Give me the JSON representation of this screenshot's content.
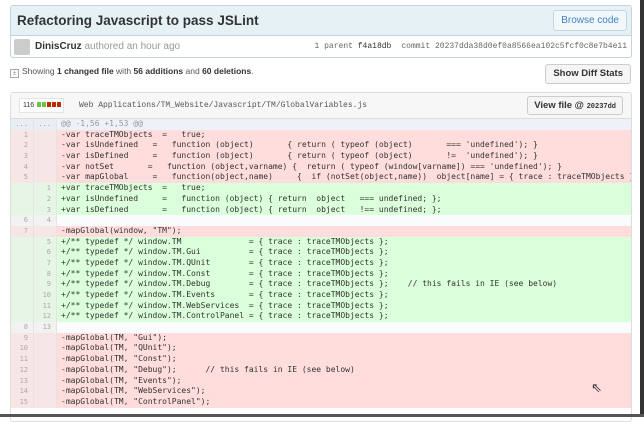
{
  "commit": {
    "title": "Refactoring Javascript to pass JSLint",
    "browse_label": "Browse code",
    "author": "DinisCruz",
    "authored": "authored an hour ago",
    "parent_label": "1 parent",
    "parent_sha": "f4a18db",
    "commit_label": "commit",
    "commit_sha": "20237dda38d0ef0a8566ea102c5fcf0c8e7b4e11"
  },
  "summary": {
    "prefix": "Showing",
    "files": "1 changed file",
    "with": "with",
    "additions": "56 additions",
    "and": "and",
    "deletions": "60 deletions",
    "suffix": ".",
    "stats_button": "Show Diff Stats"
  },
  "file": {
    "changes": "116",
    "path": "Web Applications/TM_Website/Javascript/TM/GlobalVariables.js",
    "view_label": "View file @",
    "view_sha": "20237dd",
    "bar_colors": [
      "#6cc644",
      "#6cc644",
      "#bd2c00",
      "#bd2c00",
      "#bd2c00"
    ]
  },
  "diff": [
    {
      "t": "hunk",
      "o": "...",
      "n": "...",
      "c": "@@ -1,56 +1,53 @@"
    },
    {
      "t": "del",
      "o": "1",
      "n": "",
      "c": "-var traceTMObjects  =   true;"
    },
    {
      "t": "del",
      "o": "2",
      "n": "",
      "c": "-var isUndefined   =   function (object)       { return ( typeof (object)       === 'undefined'); }"
    },
    {
      "t": "del",
      "o": "3",
      "n": "",
      "c": "-var isDefined     =   function (object)       { return ( typeof (object)       !=  'undefined'); }"
    },
    {
      "t": "del",
      "o": "4",
      "n": "",
      "c": "-var notSet       =   function (object,varname) {  return ( typeof (window[varname]) === 'undefined'); }"
    },
    {
      "t": "del",
      "o": "5",
      "n": "",
      "c": "-var mapGlobal     =   function(object,name)     {  if (notSet(object,name))  object[name] = { trace : traceTMObjects };"
    },
    {
      "t": "add",
      "o": "",
      "n": "1",
      "c": "+var traceTMObjects  =   true;"
    },
    {
      "t": "add",
      "o": "",
      "n": "2",
      "c": "+var isUndefined     =   function (object) { return  object   === undefined; };"
    },
    {
      "t": "add",
      "o": "",
      "n": "3",
      "c": "+var isDefined       =   function (object) { return  object   !== undefined; };"
    },
    {
      "t": "ctx",
      "o": "6",
      "n": "4",
      "c": ""
    },
    {
      "t": "del",
      "o": "7",
      "n": "",
      "c": "-mapGlobal(window, \"TM\");"
    },
    {
      "t": "add",
      "o": "",
      "n": "5",
      "c": "+/** typedef */ window.TM              = { trace : traceTMObjects };"
    },
    {
      "t": "add",
      "o": "",
      "n": "6",
      "c": "+/** typedef */ window.TM.Gui          = { trace : traceTMObjects };"
    },
    {
      "t": "add",
      "o": "",
      "n": "7",
      "c": "+/** typedef */ window.TM.QUnit        = { trace : traceTMObjects };"
    },
    {
      "t": "add",
      "o": "",
      "n": "8",
      "c": "+/** typedef */ window.TM.Const        = { trace : traceTMObjects };"
    },
    {
      "t": "add",
      "o": "",
      "n": "9",
      "c": "+/** typedef */ window.TM.Debug        = { trace : traceTMObjects };    // this fails in IE (see below)"
    },
    {
      "t": "add",
      "o": "",
      "n": "10",
      "c": "+/** typedef */ window.TM.Events       = { trace : traceTMObjects };"
    },
    {
      "t": "add",
      "o": "",
      "n": "11",
      "c": "+/** typedef */ window.TM.WebServices  = { trace : traceTMObjects };"
    },
    {
      "t": "add",
      "o": "",
      "n": "12",
      "c": "+/** typedef */ window.TM.ControlPanel = { trace : traceTMObjects };"
    },
    {
      "t": "ctx",
      "o": "8",
      "n": "13",
      "c": ""
    },
    {
      "t": "del",
      "o": "9",
      "n": "",
      "c": "-mapGlobal(TM, \"Gui\");"
    },
    {
      "t": "del",
      "o": "10",
      "n": "",
      "c": "-mapGlobal(TM, \"QUnit\");"
    },
    {
      "t": "del",
      "o": "11",
      "n": "",
      "c": "-mapGlobal(TM, \"Const\");"
    },
    {
      "t": "del",
      "o": "12",
      "n": "",
      "c": "-mapGlobal(TM, \"Debug\");      // this fails in IE (see below)"
    },
    {
      "t": "del",
      "o": "13",
      "n": "",
      "c": "-mapGlobal(TM, \"Events\");"
    },
    {
      "t": "del",
      "o": "14",
      "n": "",
      "c": "-mapGlobal(TM, \"WebServices\");"
    },
    {
      "t": "del",
      "o": "15",
      "n": "",
      "c": "-mapGlobal(TM, \"ControlPanel\");"
    }
  ]
}
